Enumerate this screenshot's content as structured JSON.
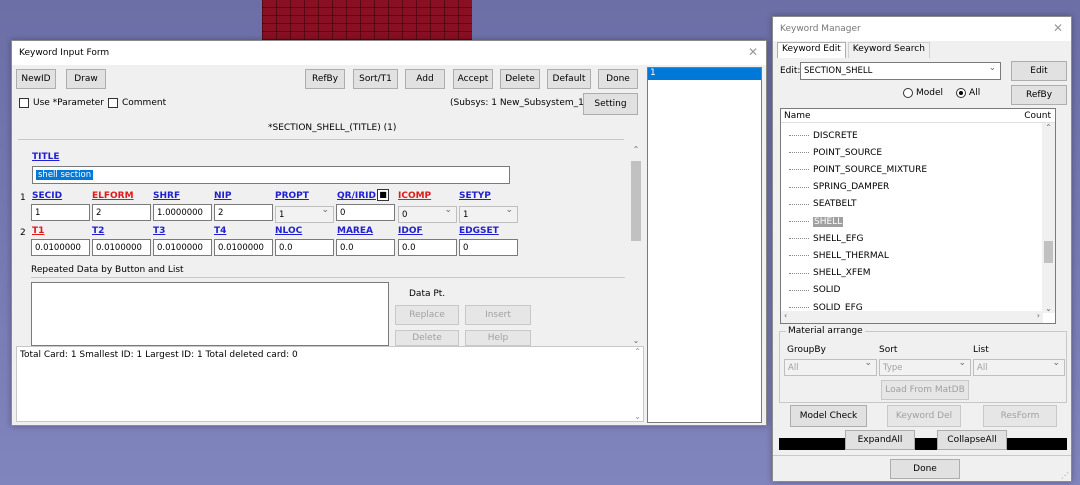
{
  "form": {
    "title": "Keyword Input Form",
    "buttons": {
      "newid": "NewID",
      "draw": "Draw",
      "refby": "RefBy",
      "sort": "Sort/T1",
      "add": "Add",
      "accept": "Accept",
      "delete": "Delete",
      "default": "Default",
      "done": "Done",
      "setting": "Setting"
    },
    "use_param": "Use *Parameter",
    "comment": "Comment",
    "subsys": "(Subsys: 1 New_Subsystem_1)",
    "keyword_header": "*SECTION_SHELL_(TITLE)   (1)",
    "title_label": "TITLE",
    "title_value": "shell section",
    "row1": {
      "num": "1",
      "labels": [
        "SECID",
        "ELFORM",
        "SHRF",
        "NIP",
        "PROPT",
        "QR/IRID",
        "ICOMP",
        "SETYP"
      ],
      "values": [
        "1",
        "2",
        "1.0000000",
        "2",
        "1",
        "0",
        "0",
        "1"
      ]
    },
    "row2": {
      "num": "2",
      "labels": [
        "T1",
        "T2",
        "T3",
        "T4",
        "NLOC",
        "MAREA",
        "IDOF",
        "EDGSET"
      ],
      "values": [
        "0.0100000",
        "0.0100000",
        "0.0100000",
        "0.0100000",
        "0.0",
        "0.0",
        "0.0",
        "0"
      ]
    },
    "repeated_label": "Repeated Data by Button and List",
    "data_pt": "Data Pt.",
    "rep_buttons": {
      "replace": "Replace",
      "insert": "Insert",
      "delete": "Delete",
      "help": "Help"
    },
    "status": "Total Card: 1   Smallest ID: 1   Largest ID: 1   Total deleted card: 0",
    "side_list": [
      "1"
    ]
  },
  "manager": {
    "title": "Keyword Manager",
    "tabs": [
      "Keyword Edit",
      "Keyword Search"
    ],
    "edit_label": "Edit:",
    "edit_value": "SECTION_SHELL",
    "edit_button": "Edit",
    "radio_model": "Model",
    "radio_all": "All",
    "refby": "RefBy",
    "col_name": "Name",
    "col_count": "Count",
    "tree": [
      "DISCRETE",
      "POINT_SOURCE",
      "POINT_SOURCE_MIXTURE",
      "SPRING_DAMPER",
      "SEATBELT",
      "SHELL",
      "SHELL_EFG",
      "SHELL_THERMAL",
      "SHELL_XFEM",
      "SOLID",
      "SOLID_EFG"
    ],
    "selected_index": 5,
    "material_arrange": "Material arrange",
    "groupby": "GroupBy",
    "sort": "Sort",
    "list": "List",
    "groupby_value": "All",
    "sort_value": "Type",
    "list_value": "All",
    "load_matdb": "Load From MatDB",
    "model_check": "Model Check",
    "keyword_del": "Keyword Del",
    "resform": "ResForm",
    "expand_all": "ExpandAll",
    "collapse_all": "CollapseAll",
    "done": "Done"
  },
  "colors": {
    "accent": "#0078d7",
    "link": "#1f1fd0",
    "required": "#e01818",
    "background": "#7377b0"
  }
}
